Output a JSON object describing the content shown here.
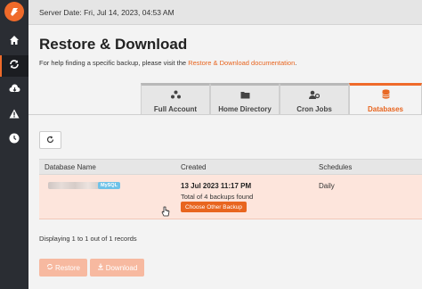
{
  "topbar": {
    "server_date": "Server Date: Fri, Jul 14, 2023, 04:53 AM"
  },
  "sidebar": {
    "items": [
      {
        "icon": "home-icon"
      },
      {
        "icon": "restore-icon",
        "active": true
      },
      {
        "icon": "cloud-download-icon"
      },
      {
        "icon": "warning-icon"
      },
      {
        "icon": "clock-icon"
      }
    ]
  },
  "page": {
    "title": "Restore & Download",
    "help_prefix": "For help finding a specific backup, please visit the ",
    "help_link": "Restore & Download documentation",
    "help_suffix": "."
  },
  "tabs": [
    {
      "label": "Full Account",
      "icon": "network-icon"
    },
    {
      "label": "Home Directory",
      "icon": "folder-icon"
    },
    {
      "label": "Cron Jobs",
      "icon": "user-gear-icon"
    },
    {
      "label": "Databases",
      "icon": "database-icon",
      "active": true
    }
  ],
  "table": {
    "headers": [
      "Database Name",
      "Created",
      "Schedules"
    ],
    "rows": [
      {
        "db_type_badge": "MySQL",
        "created": "13 Jul 2023 11:17 PM",
        "total": "Total of 4 backups found",
        "choose_button": "Choose Other Backup",
        "schedule": "Daily"
      }
    ]
  },
  "records_info": "Displaying 1 to 1 out of 1 records",
  "actions": {
    "restore": "Restore",
    "download": "Download"
  },
  "colors": {
    "accent": "#e8651f",
    "sidebar": "#2a2d33",
    "row_highlight": "#fde5dc",
    "badge": "#6fc2e8"
  }
}
